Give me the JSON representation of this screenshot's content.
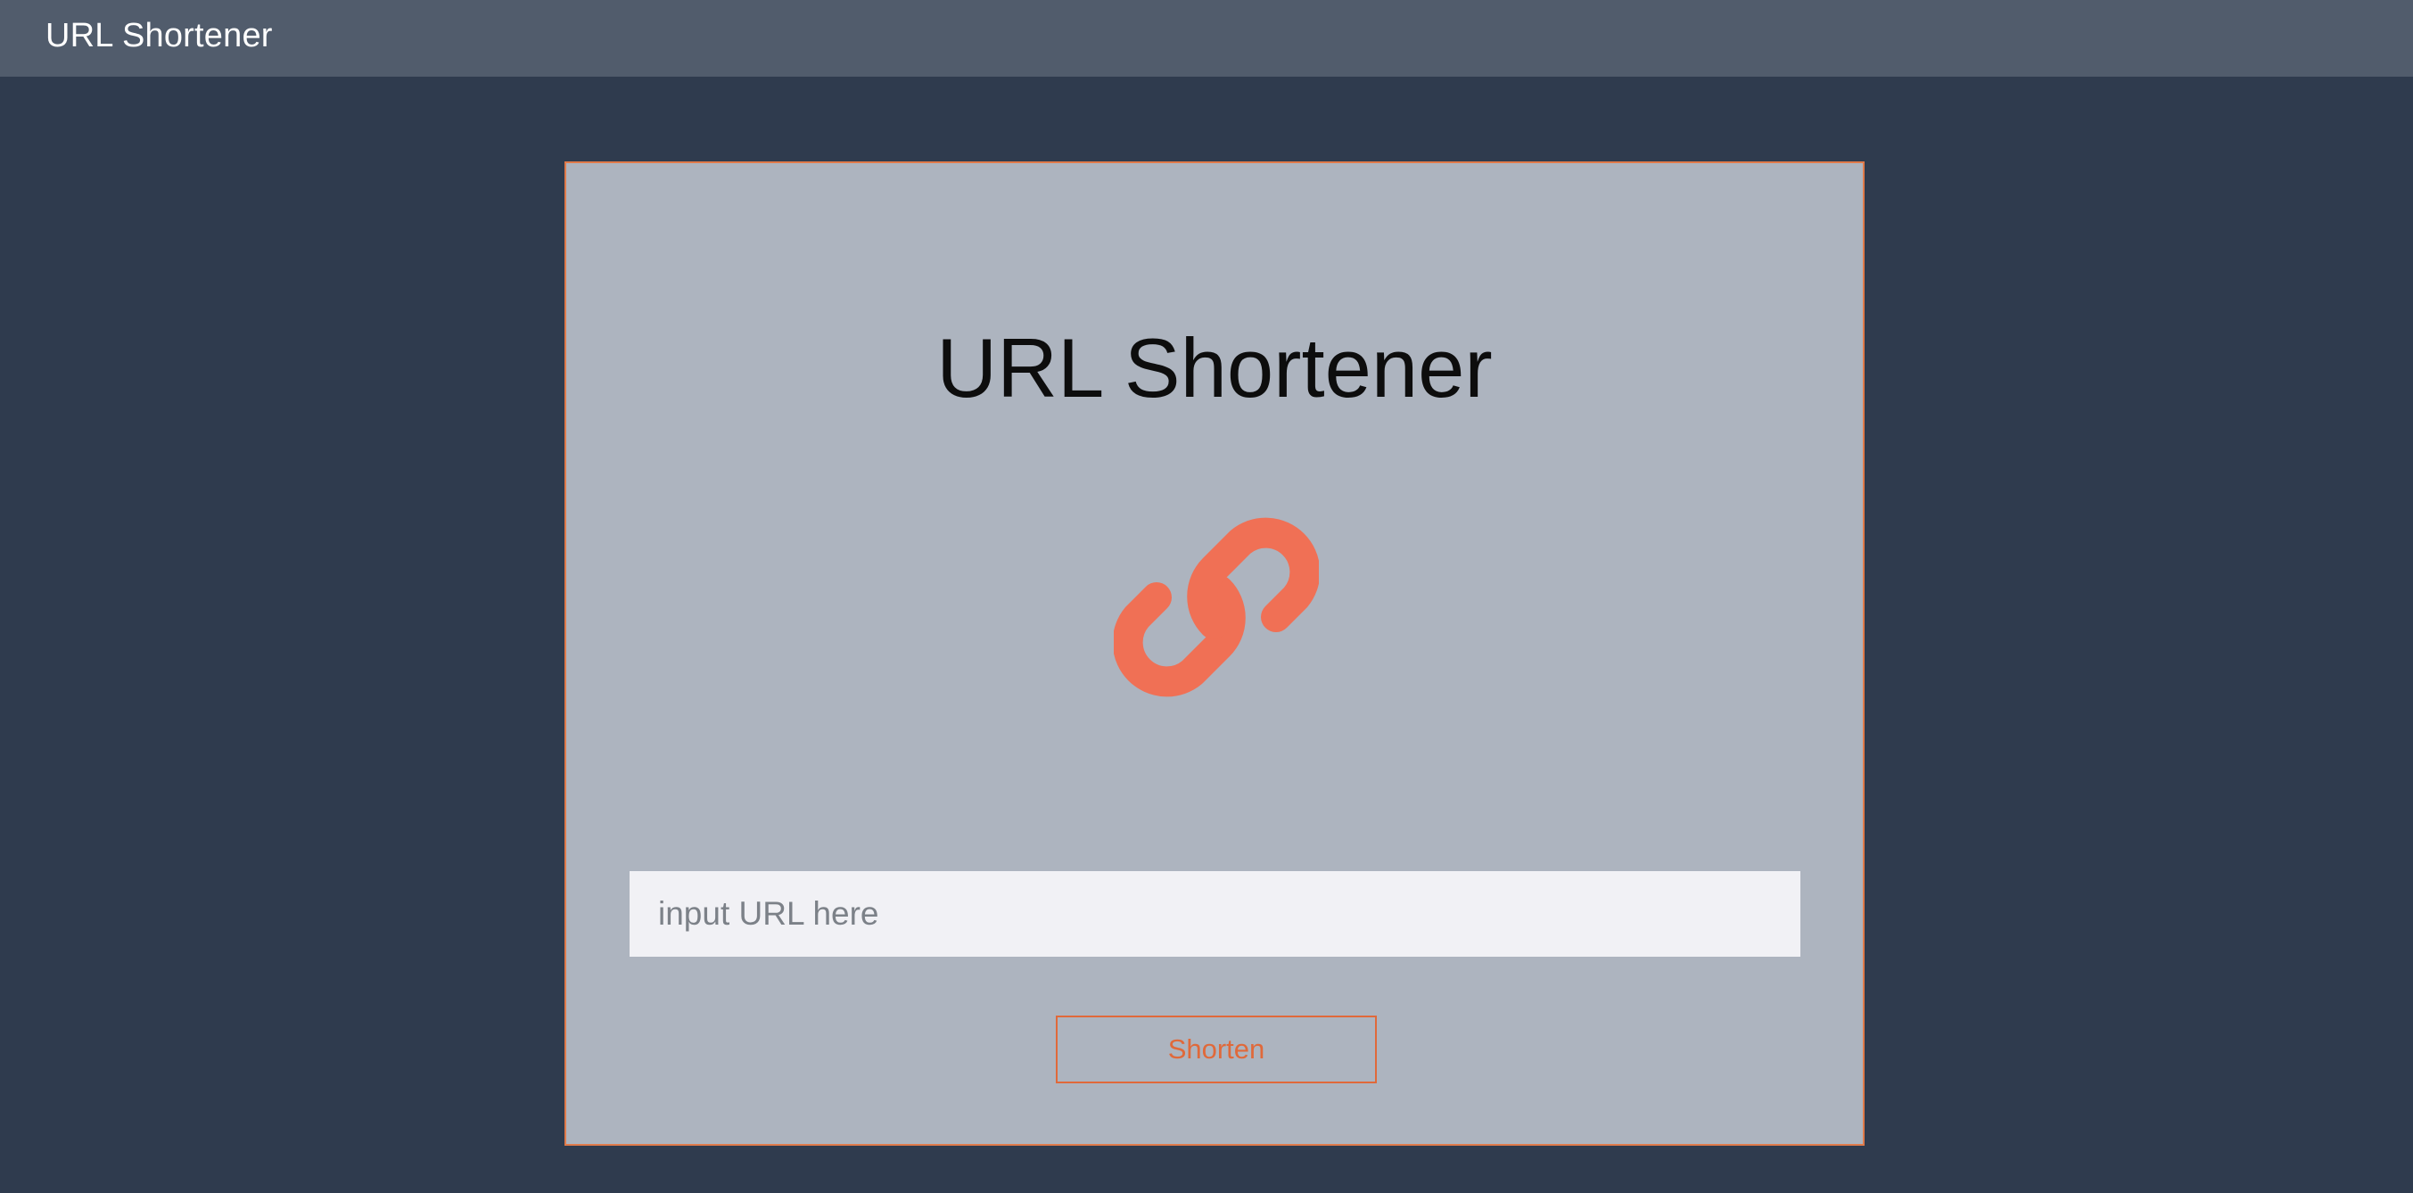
{
  "navbar": {
    "title": "URL Shortener"
  },
  "card": {
    "title": "URL Shortener",
    "icon": "link-icon",
    "input": {
      "value": "",
      "placeholder": "input URL here"
    },
    "button_label": "Shorten"
  },
  "colors": {
    "page_background": "#2f3b4e",
    "navbar_background": "#515c6c",
    "card_background": "#adb4bf",
    "accent": "#e0693a",
    "icon": "#f07055"
  }
}
